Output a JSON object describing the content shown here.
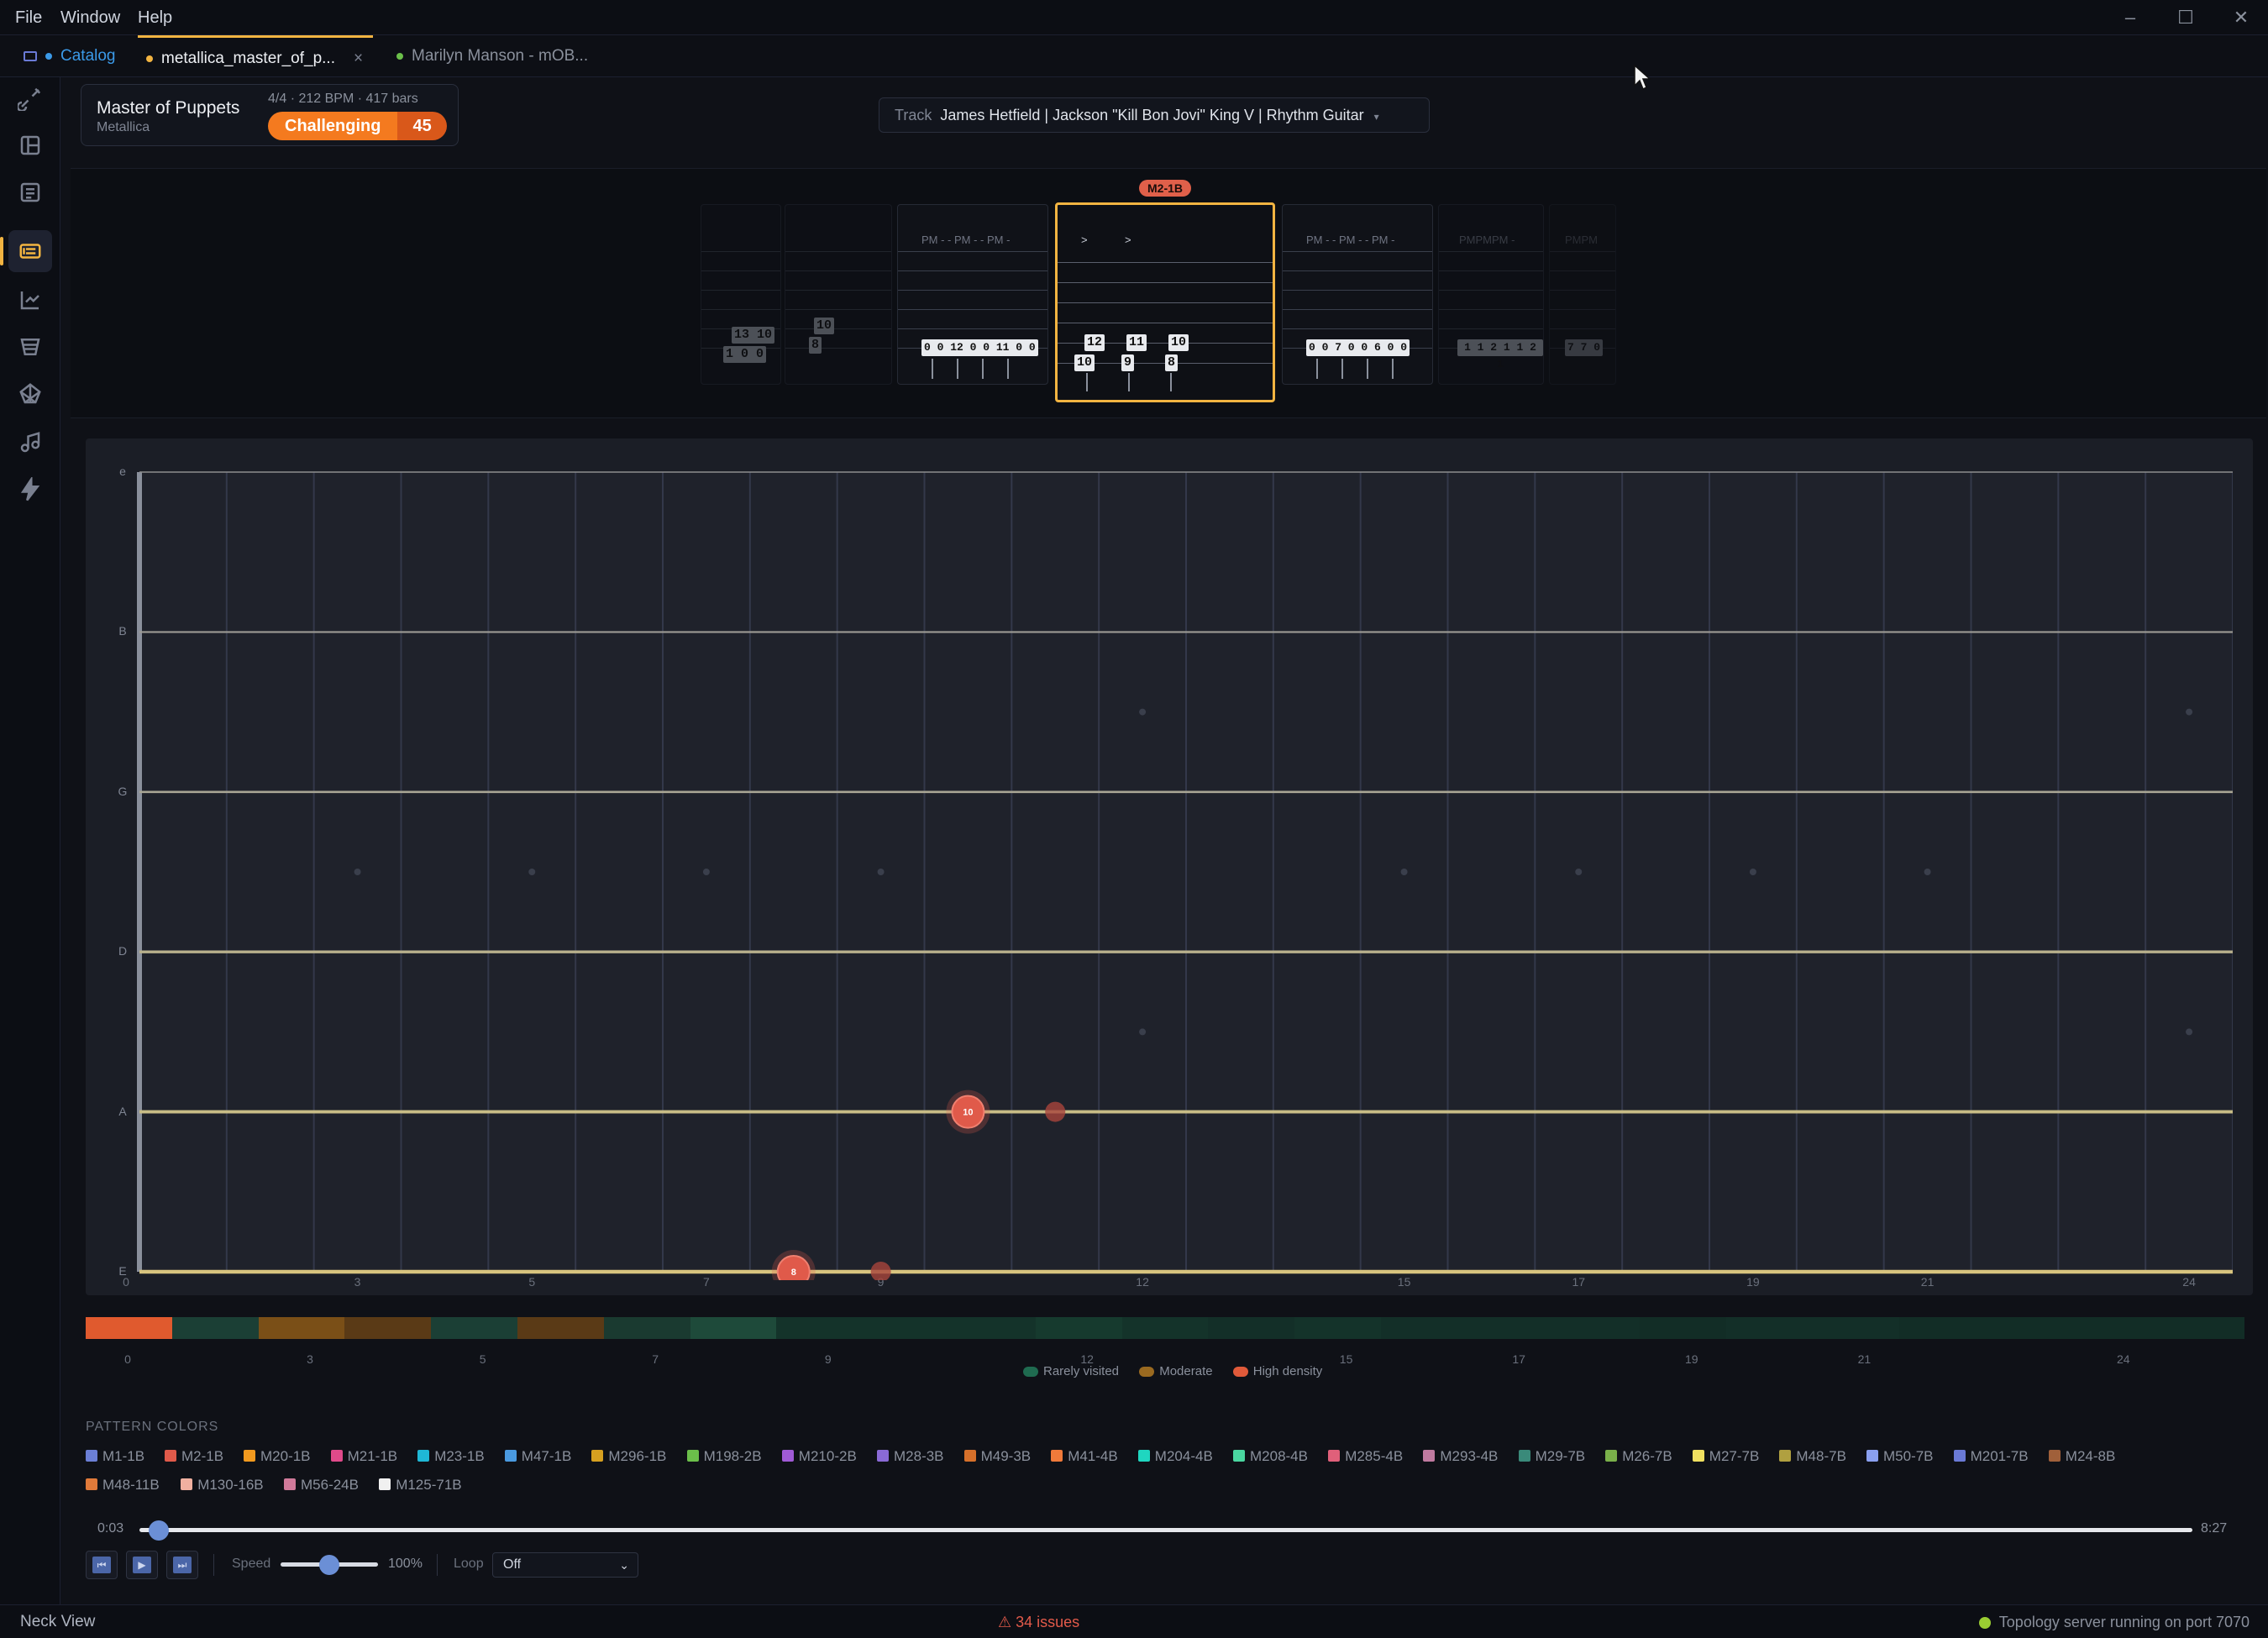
{
  "menu": {
    "items": [
      "File",
      "Window",
      "Help"
    ]
  },
  "tabs": [
    {
      "label": "Catalog",
      "dot_color": "#3b9ae8"
    },
    {
      "label": "metallica_master_of_p...",
      "dot_color": "#f2b441",
      "close": "×"
    },
    {
      "label": "Marilyn Manson - mOB...",
      "dot_color": "#6bbf4a"
    }
  ],
  "rail_icons": [
    "guitar-icon",
    "dashboard-icon",
    "list-icon",
    "neck-view-icon",
    "flow-icon",
    "funnel-icon",
    "web-icon",
    "music-node-icon",
    "lightning-icon"
  ],
  "song": {
    "title": "Master of Puppets",
    "artist": "Metallica",
    "meta": "4/4 · 212 BPM · 417 bars",
    "difficulty": "Challenging",
    "score": "45"
  },
  "track": {
    "label": "Track",
    "value": "James Hetfield | Jackson \"Kill Bon Jovi\" King V | Rhythm Guitar"
  },
  "tab_strip": {
    "current_tag": "M2-1B",
    "pm_groups": [
      "PM - - PM - - PM -",
      "PM - - PM - - PM -",
      "PMPMPM -",
      "PMPM"
    ],
    "current_accents": [
      ">",
      ">"
    ],
    "measures": [
      {
        "notes": [
          "13 10",
          "1 0 0"
        ]
      },
      {
        "notes": [
          "10",
          "8"
        ]
      },
      {
        "notes": [
          "0 0 12 0 0 11 0 0"
        ]
      },
      {
        "notes": [
          "12",
          "11",
          "10",
          "10",
          "9",
          "8"
        ]
      },
      {
        "notes": [
          "0 0 7 0 0 6 0 0"
        ]
      },
      {
        "notes": [
          "1 1 2 1 1 2 1"
        ]
      },
      {
        "notes": [
          "7 7 0"
        ]
      }
    ]
  },
  "fretboard": {
    "strings": [
      "e",
      "B",
      "G",
      "D",
      "A",
      "E"
    ],
    "fret_count": 24,
    "fret_labels": [
      "0",
      "3",
      "5",
      "7",
      "9",
      "12",
      "15",
      "17",
      "19",
      "21",
      "24"
    ],
    "inlay_frets": [
      3,
      5,
      7,
      9,
      15,
      17,
      19,
      21
    ],
    "double_inlays": [
      12,
      24
    ],
    "notes": [
      {
        "string": "A",
        "fret": 10,
        "label": "10",
        "kind": "active"
      },
      {
        "string": "A",
        "fret": 11,
        "label": "",
        "kind": "ghost"
      },
      {
        "string": "E",
        "fret": 8,
        "label": "8",
        "kind": "active"
      },
      {
        "string": "E",
        "fret": 9,
        "label": "",
        "kind": "ghost"
      }
    ]
  },
  "heatmap": {
    "colors": [
      "#e05a2e",
      "#1b3f35",
      "#7a4f17",
      "#5a3a16",
      "#1b3f35",
      "#5a3a16",
      "#1a3a30",
      "#1e4a3a",
      "#14332a",
      "#14332a",
      "#14332a",
      "#163a2e",
      "#14332a",
      "#132f28",
      "#14332a",
      "#132f28",
      "#132f28",
      "#132f28",
      "#122d26",
      "#132f28",
      "#132f28",
      "#122d26",
      "#122d26",
      "#122d26",
      "#122d26"
    ],
    "labels": [
      "0",
      "3",
      "5",
      "7",
      "9",
      "12",
      "15",
      "17",
      "19",
      "21",
      "24"
    ],
    "legend": [
      {
        "label": "Rarely visited",
        "color": "#1f6b50"
      },
      {
        "label": "Moderate",
        "color": "#9a6a20"
      },
      {
        "label": "High density",
        "color": "#e05a3a"
      }
    ]
  },
  "patterns": {
    "title": "PATTERN COLORS",
    "items": [
      {
        "label": "M1-1B",
        "color": "#6b7fd6"
      },
      {
        "label": "M2-1B",
        "color": "#e05a4a"
      },
      {
        "label": "M20-1B",
        "color": "#f29a1f"
      },
      {
        "label": "M21-1B",
        "color": "#e04a8a"
      },
      {
        "label": "M23-1B",
        "color": "#1fb8d6"
      },
      {
        "label": "M47-1B",
        "color": "#4a9ae0"
      },
      {
        "label": "M296-1B",
        "color": "#d6a020"
      },
      {
        "label": "M198-2B",
        "color": "#6bbf4a"
      },
      {
        "label": "M210-2B",
        "color": "#a05ad6"
      },
      {
        "label": "M28-3B",
        "color": "#8a6ad6"
      },
      {
        "label": "M49-3B",
        "color": "#d6702a"
      },
      {
        "label": "M41-4B",
        "color": "#f07a3a"
      },
      {
        "label": "M204-4B",
        "color": "#1fd6c0"
      },
      {
        "label": "M208-4B",
        "color": "#4ad6a0"
      },
      {
        "label": "M285-4B",
        "color": "#e0607a"
      },
      {
        "label": "M293-4B",
        "color": "#c07aa0"
      },
      {
        "label": "M29-7B",
        "color": "#3a8a7a"
      },
      {
        "label": "M26-7B",
        "color": "#7ab04a"
      },
      {
        "label": "M27-7B",
        "color": "#f0e060"
      },
      {
        "label": "M48-7B",
        "color": "#b0a040"
      },
      {
        "label": "M50-7B",
        "color": "#8aa0f0"
      },
      {
        "label": "M201-7B",
        "color": "#6a7ad6"
      },
      {
        "label": "M24-8B",
        "color": "#a0603a"
      },
      {
        "label": "M48-11B",
        "color": "#e07a3a"
      },
      {
        "label": "M130-16B",
        "color": "#f0b0a0"
      },
      {
        "label": "M56-24B",
        "color": "#d07a9a"
      },
      {
        "label": "M125-71B",
        "color": "#f0f0f0"
      }
    ]
  },
  "transport": {
    "time_start": "0:03",
    "time_end": "8:27",
    "progress": 0.006,
    "speed_label": "Speed",
    "speed_value": "100%",
    "speed_fraction": 0.5,
    "loop_label": "Loop",
    "loop_value": "Off",
    "buttons": [
      "skip-back-icon",
      "play-icon",
      "skip-forward-icon"
    ]
  },
  "status": {
    "view": "Neck View",
    "issues": "⚠ 34 issues",
    "server": "Topology server running on port 7070"
  }
}
